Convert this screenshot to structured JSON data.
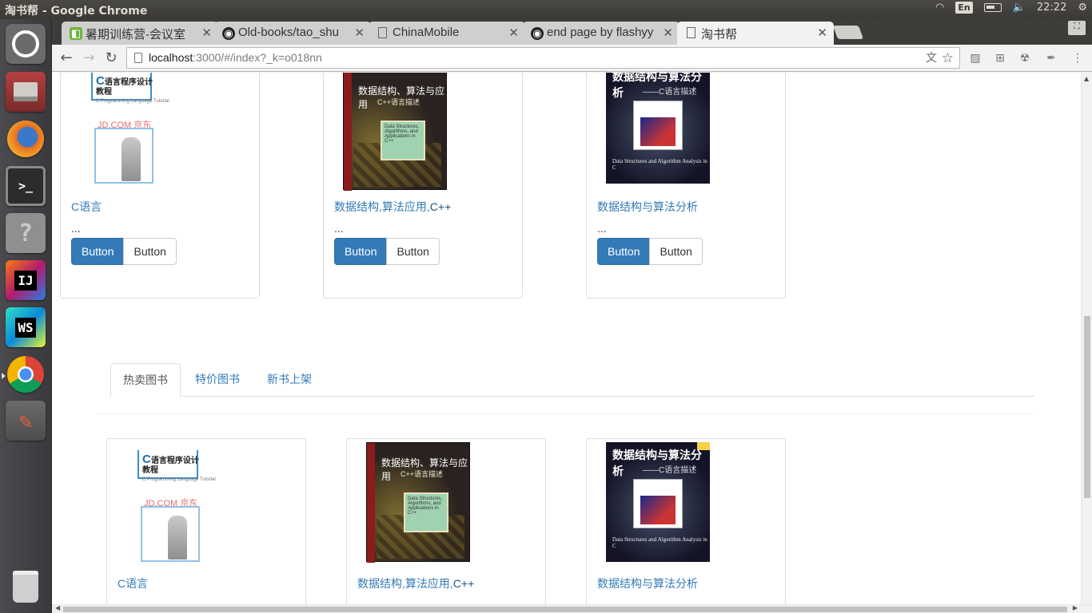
{
  "window": {
    "title": "淘书帮 - Google Chrome"
  },
  "tray": {
    "keyboard": "En",
    "time": "22:22"
  },
  "launcher": {
    "items": [
      {
        "name": "ubuntu-dash-icon"
      },
      {
        "name": "files-icon"
      },
      {
        "name": "firefox-icon"
      },
      {
        "name": "terminal-icon",
        "glyph": ">_"
      },
      {
        "name": "help-icon",
        "glyph": "?"
      },
      {
        "name": "intellij-icon",
        "glyph": "IJ"
      },
      {
        "name": "webstorm-icon",
        "glyph": "WS"
      },
      {
        "name": "chrome-icon"
      },
      {
        "name": "settings-icon"
      },
      {
        "name": "trash-icon"
      }
    ]
  },
  "browser": {
    "tabs": [
      {
        "title": "暑期训练营-会议室",
        "icon": "app-icon"
      },
      {
        "title": "Old-books/tao_shu",
        "icon": "github-icon"
      },
      {
        "title": "ChinaMobile",
        "icon": "page-icon"
      },
      {
        "title": "end page by flashyy",
        "icon": "github-icon"
      },
      {
        "title": "淘书帮",
        "icon": "page-icon",
        "active": true
      }
    ],
    "url": {
      "host": "localhost",
      "rest": ":3000/#/index?_k=o018nn"
    }
  },
  "page": {
    "top_cards": [
      {
        "title_plain": "C语言",
        "title_em": "",
        "desc": "...",
        "primary": "Button",
        "secondary": "Button"
      },
      {
        "title_plain": "数据结构,算法应用,",
        "title_em": "C++",
        "desc": "...",
        "primary": "Button",
        "secondary": "Button"
      },
      {
        "title_plain": "数据结构与算法分析",
        "title_em": "",
        "desc": "...",
        "primary": "Button",
        "secondary": "Button"
      }
    ],
    "tabs": [
      {
        "label": "热卖图书",
        "active": true
      },
      {
        "label": "特价图书",
        "active": false
      },
      {
        "label": "新书上架",
        "active": false
      }
    ],
    "bottom_cards": [
      {
        "title_plain": "C语言",
        "title_em": "",
        "desc": "..."
      },
      {
        "title_plain": "数据结构,算法应用,",
        "title_em": "C++",
        "desc": "..."
      },
      {
        "title_plain": "数据结构与算法分析",
        "title_em": "",
        "desc": "..."
      }
    ],
    "covers": {
      "c": {
        "title_big": "C",
        "title": "语言程序设计",
        "title2": "教程",
        "sub": "C Programming Language Tutorial",
        "store": "JD.COM 京东"
      },
      "ds": {
        "title": "数据结构、算法与应用",
        "subtitle": "C++语言描述",
        "inner": "Data Structures, Algorithms, and Applications in C++"
      },
      "alg": {
        "title": "数据结构与算法分析",
        "subtitle": "——C语言描述",
        "en": "Data Structures and Algorithm Analysis in C"
      }
    }
  }
}
